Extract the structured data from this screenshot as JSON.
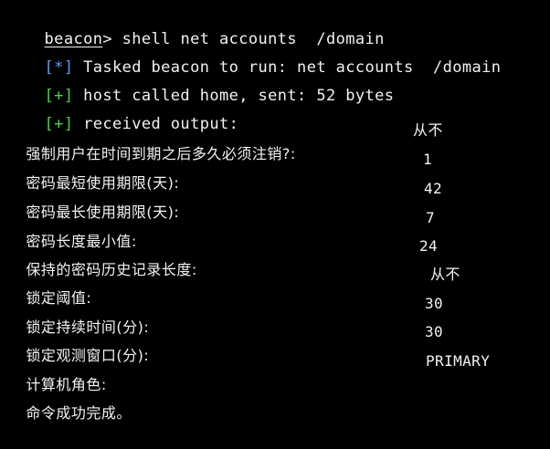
{
  "colors": {
    "background": "#000000",
    "text": "#f2f2f2",
    "info_bracket": "#5a9bff",
    "ok_bracket": "#3edc3e"
  },
  "prompt": {
    "name": "beacon",
    "separator": ">",
    "command": " shell net accounts  /domain"
  },
  "messages": [
    {
      "marker": "[*]",
      "text": " Tasked beacon to run: net accounts  /domain"
    },
    {
      "marker": "[+]",
      "text": " host called home, sent: 52 bytes"
    },
    {
      "marker": "[+]",
      "text": " received output:"
    }
  ],
  "output": [
    {
      "label": "强制用户在时间到期之后多久必须注销?:",
      "value": "从不"
    },
    {
      "label": "密码最短使用期限(天):",
      "value": "1"
    },
    {
      "label": "密码最长使用期限(天):",
      "value": "42"
    },
    {
      "label": "密码长度最小值:",
      "value": "7"
    },
    {
      "label": "保持的密码历史记录长度:",
      "value": "24"
    },
    {
      "label": "锁定阈值:",
      "value": "从不"
    },
    {
      "label": "锁定持续时间(分):",
      "value": "30"
    },
    {
      "label": "锁定观测窗口(分):",
      "value": "30"
    },
    {
      "label": "计算机角色:",
      "value": "PRIMARY"
    }
  ],
  "completion": "命令成功完成。"
}
